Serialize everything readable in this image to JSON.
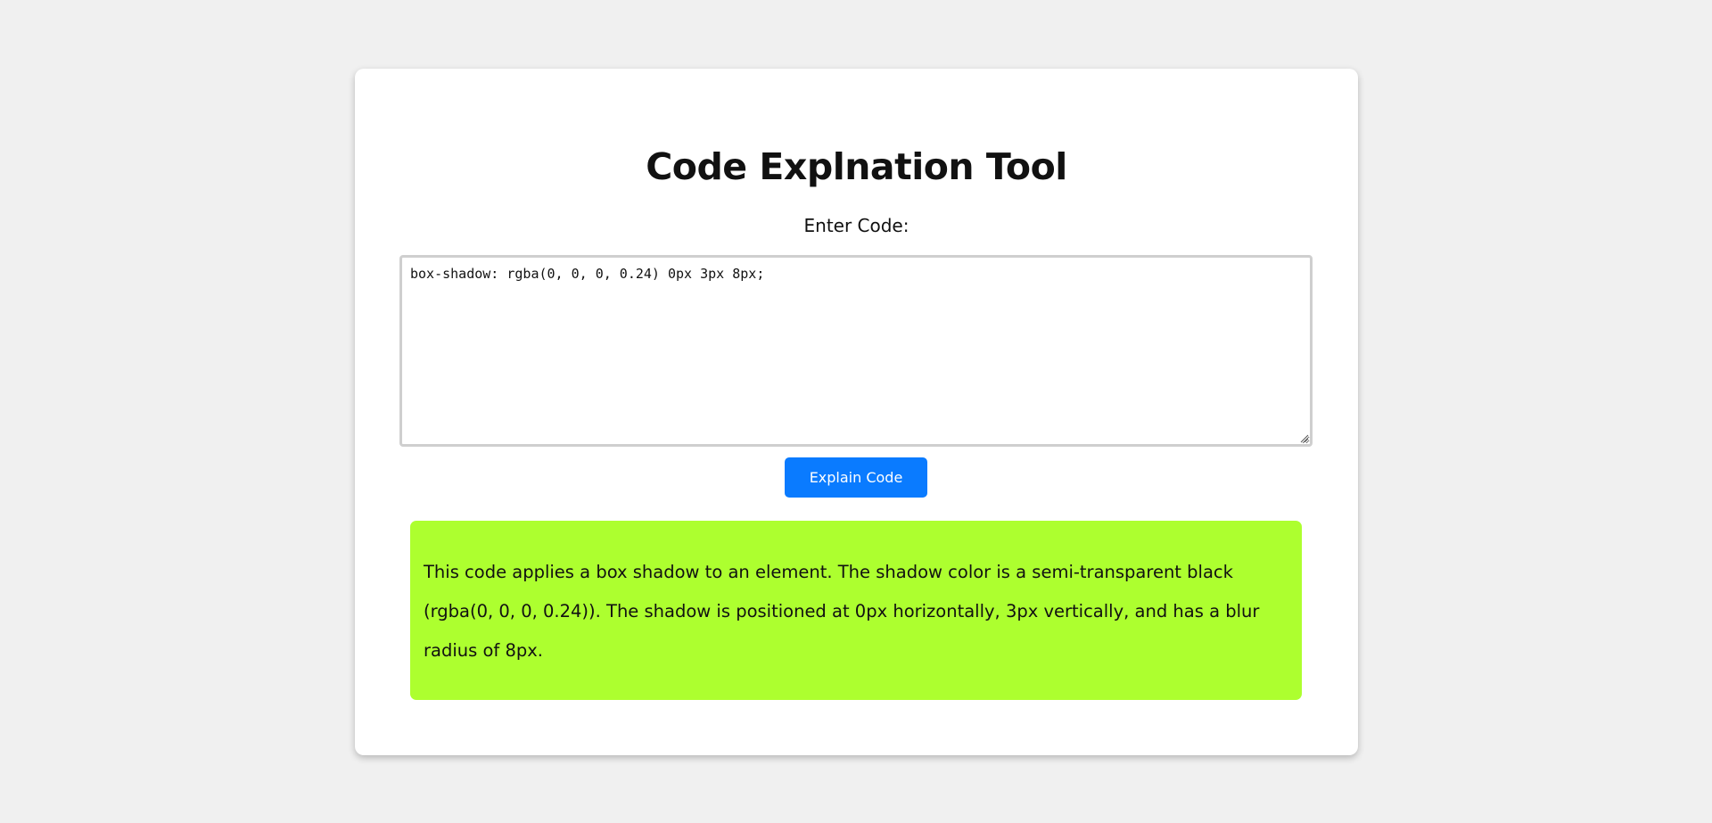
{
  "page": {
    "title": "Code Explnation Tool",
    "input_label": "Enter Code:"
  },
  "editor": {
    "code": "box-shadow: rgba(0, 0, 0, 0.24) 0px 3px 8px;"
  },
  "actions": {
    "explain_label": "Explain Code"
  },
  "result": {
    "text": "This code applies a box shadow to an element. The shadow color is a semi-transparent black (rgba(0, 0, 0, 0.24)). The shadow is positioned at 0px horizontally, 3px vertically, and has a blur radius of 8px."
  },
  "colors": {
    "page_background": "#f0f0f0",
    "card_background": "#ffffff",
    "button_background": "#0a7bff",
    "result_background": "#adff2f"
  }
}
